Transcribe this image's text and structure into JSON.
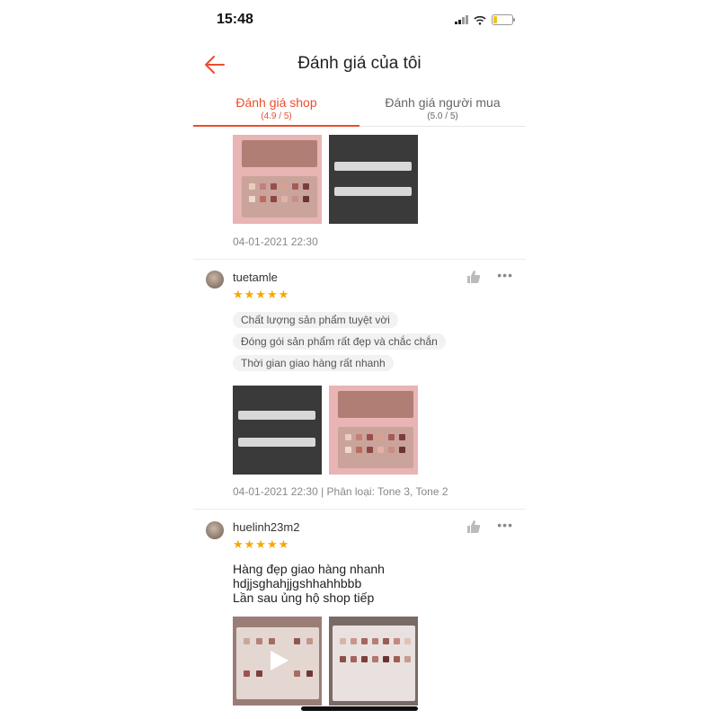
{
  "status_bar": {
    "time": "15:48"
  },
  "header": {
    "title": "Đánh giá của tôi"
  },
  "tabs": [
    {
      "label": "Đánh giá shop",
      "rating": "(4.9 / 5)",
      "active": true
    },
    {
      "label": "Đánh giá người mua",
      "rating": "(5.0 / 5)",
      "active": false
    }
  ],
  "reviews": [
    {
      "images": [
        "palette-pink",
        "palette-gray-box"
      ],
      "meta": "04-01-2021 22:30"
    },
    {
      "username": "tuetamle",
      "stars": "★★★★★",
      "tags": [
        "Chất lượng sản phẩm tuyệt vời",
        "Đóng gói sản phẩm rất đẹp và chắc chắn",
        "Thời gian giao hàng rất nhanh"
      ],
      "images": [
        "palette-gray-box",
        "palette-pink"
      ],
      "meta": "04-01-2021 22:30 | Phân loại: Tone 3, Tone 2"
    },
    {
      "username": "huelinh23m2",
      "stars": "★★★★★",
      "comment": [
        "Hàng đẹp giao hàng nhanh",
        "hdjjsghahjjgshhahhbbb",
        "Lần sau ủng hộ shop tiếp"
      ],
      "images": [
        "video-palette-white",
        "palette-open"
      ]
    }
  ],
  "icons": {
    "back": "back-arrow-icon",
    "like": "thumbs-up-icon",
    "more": "more-dots-icon",
    "play": "play-icon"
  },
  "colors": {
    "accent": "#ee4d2d",
    "star": "#f6a700"
  }
}
